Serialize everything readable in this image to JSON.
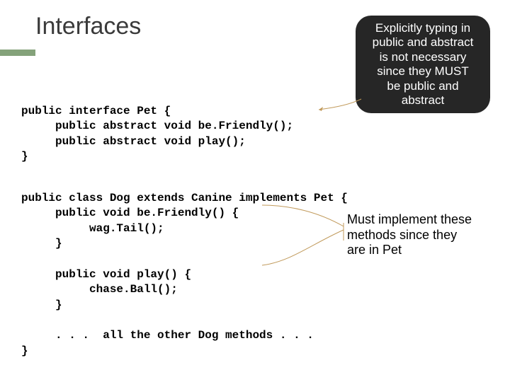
{
  "title": "Interfaces",
  "callout1": {
    "l1": "Explicitly typing in",
    "l2": "public and abstract",
    "l3": "is not necessary",
    "l4": "since they MUST",
    "l5": "be public and",
    "l6": "abstract"
  },
  "code1": {
    "l1": "public interface Pet {",
    "l2": "     public abstract void be.Friendly();",
    "l3": "     public abstract void play();",
    "l4": "}"
  },
  "code2": {
    "l1": "public class Dog extends Canine implements Pet {",
    "l2": "     public void be.Friendly() {",
    "l3": "          wag.Tail();",
    "l4": "     }",
    "l5": "",
    "l6": "     public void play() {",
    "l7": "          chase.Ball();",
    "l8": "     }",
    "l9": "",
    "l10": "     . . .  all the other Dog methods . . .",
    "l11": "}"
  },
  "annotation1": {
    "l1": "Must implement these",
    "l2": "methods since they",
    "l3": "are in Pet"
  }
}
